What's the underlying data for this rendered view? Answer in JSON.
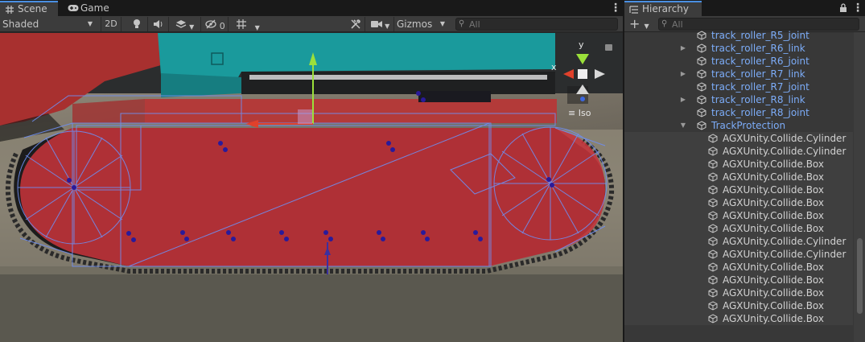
{
  "scene_panel": {
    "tabs": [
      {
        "label": "Scene",
        "icon": "grid-icon",
        "active": true
      },
      {
        "label": "Game",
        "icon": "gamepad-icon",
        "active": false
      }
    ],
    "toolbar": {
      "shading_mode": "Shaded",
      "mode_2d": "2D",
      "hidden_count": "0",
      "gizmos_label": "Gizmos",
      "search_placeholder": "All"
    },
    "gizmo": {
      "x_label": "x",
      "y_label": "y",
      "projection": "Iso"
    }
  },
  "hierarchy_panel": {
    "title": "Hierarchy",
    "search_placeholder": "All",
    "items": [
      {
        "label": "track_roller_R5_joint",
        "type": "prefab",
        "expandable": false,
        "expanded": false,
        "indent": 0
      },
      {
        "label": "track_roller_R6_link",
        "type": "prefab",
        "expandable": true,
        "expanded": false,
        "indent": 0
      },
      {
        "label": "track_roller_R6_joint",
        "type": "prefab",
        "expandable": false,
        "expanded": false,
        "indent": 0
      },
      {
        "label": "track_roller_R7_link",
        "type": "prefab",
        "expandable": true,
        "expanded": false,
        "indent": 0
      },
      {
        "label": "track_roller_R7_joint",
        "type": "prefab",
        "expandable": false,
        "expanded": false,
        "indent": 0
      },
      {
        "label": "track_roller_R8_link",
        "type": "prefab",
        "expandable": true,
        "expanded": false,
        "indent": 0
      },
      {
        "label": "track_roller_R8_joint",
        "type": "prefab",
        "expandable": false,
        "expanded": false,
        "indent": 0
      },
      {
        "label": "TrackProtection",
        "type": "prefab",
        "expandable": true,
        "expanded": true,
        "indent": 0
      },
      {
        "label": "AGXUnity.Collide.Cylinder",
        "type": "plain",
        "expandable": false,
        "expanded": false,
        "indent": 1
      },
      {
        "label": "AGXUnity.Collide.Cylinder",
        "type": "plain",
        "expandable": false,
        "expanded": false,
        "indent": 1
      },
      {
        "label": "AGXUnity.Collide.Box",
        "type": "plain",
        "expandable": false,
        "expanded": false,
        "indent": 1
      },
      {
        "label": "AGXUnity.Collide.Box",
        "type": "plain",
        "expandable": false,
        "expanded": false,
        "indent": 1
      },
      {
        "label": "AGXUnity.Collide.Box",
        "type": "plain",
        "expandable": false,
        "expanded": false,
        "indent": 1
      },
      {
        "label": "AGXUnity.Collide.Box",
        "type": "plain",
        "expandable": false,
        "expanded": false,
        "indent": 1
      },
      {
        "label": "AGXUnity.Collide.Box",
        "type": "plain",
        "expandable": false,
        "expanded": false,
        "indent": 1
      },
      {
        "label": "AGXUnity.Collide.Box",
        "type": "plain",
        "expandable": false,
        "expanded": false,
        "indent": 1
      },
      {
        "label": "AGXUnity.Collide.Cylinder",
        "type": "plain",
        "expandable": false,
        "expanded": false,
        "indent": 1
      },
      {
        "label": "AGXUnity.Collide.Cylinder",
        "type": "plain",
        "expandable": false,
        "expanded": false,
        "indent": 1
      },
      {
        "label": "AGXUnity.Collide.Box",
        "type": "plain",
        "expandable": false,
        "expanded": false,
        "indent": 1
      },
      {
        "label": "AGXUnity.Collide.Box",
        "type": "plain",
        "expandable": false,
        "expanded": false,
        "indent": 1
      },
      {
        "label": "AGXUnity.Collide.Box",
        "type": "plain",
        "expandable": false,
        "expanded": false,
        "indent": 1
      },
      {
        "label": "AGXUnity.Collide.Box",
        "type": "plain",
        "expandable": false,
        "expanded": false,
        "indent": 1
      },
      {
        "label": "AGXUnity.Collide.Box",
        "type": "plain",
        "expandable": false,
        "expanded": false,
        "indent": 1
      }
    ]
  },
  "colors": {
    "accent": "#4a8fe2",
    "prefab_text": "#7cacf8",
    "selection_collider": "#c4333a",
    "wire": "#6f8ef0",
    "axis_x": "#e0412b",
    "axis_y": "#9be03a",
    "axis_z": "#3b67e0",
    "teal_body": "#1a9a9c"
  }
}
